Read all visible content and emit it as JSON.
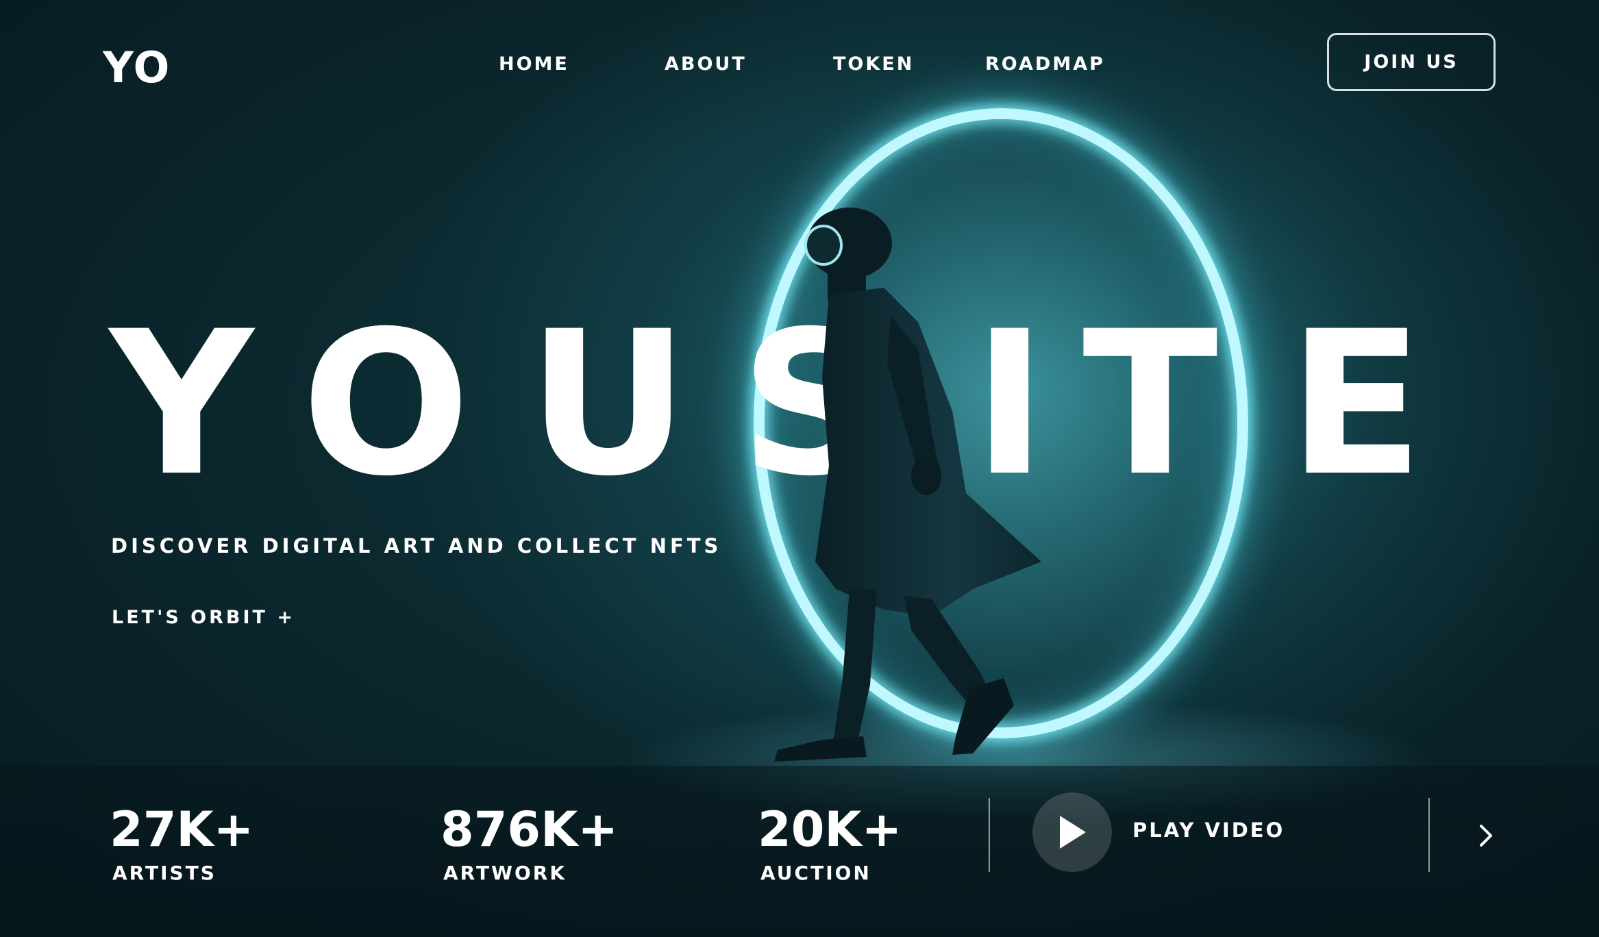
{
  "header": {
    "logo": "YO",
    "nav": [
      "HOME",
      "ABOUT",
      "TOKEN",
      "ROADMAP"
    ],
    "join_label": "JOIN US"
  },
  "hero": {
    "title_letters": [
      "Y",
      "O",
      "U",
      "S",
      "I",
      "T",
      "E"
    ],
    "subtitle": "DISCOVER DIGITAL ART AND COLLECT NFTS",
    "cta": "LET'S ORBIT +"
  },
  "stats": [
    {
      "value": "27K+",
      "label": "ARTISTS"
    },
    {
      "value": "876K+",
      "label": "ARTWORK"
    },
    {
      "value": "20K+",
      "label": "AUCTION"
    }
  ],
  "video": {
    "label": "PLAY VIDEO",
    "play_icon": "play-icon"
  },
  "colors": {
    "accent_glow": "#bff8ff",
    "background": "#123d45",
    "text": "#ffffff"
  }
}
